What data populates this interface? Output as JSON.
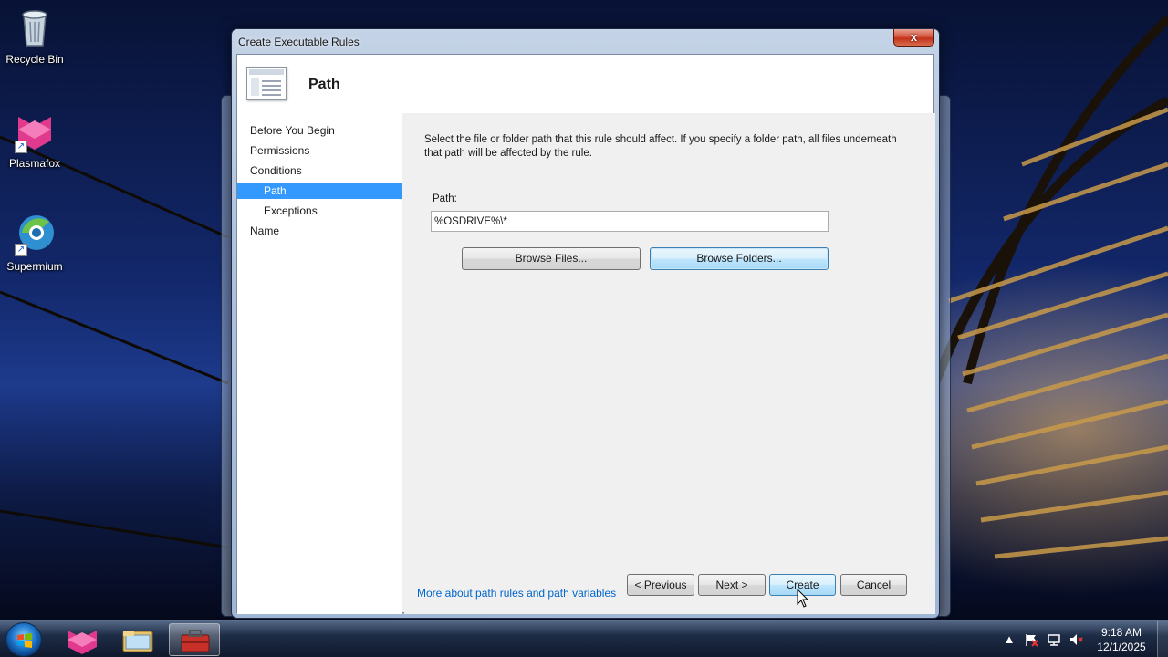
{
  "desktop": {
    "icons": [
      {
        "label": "Recycle Bin",
        "icon": "recycle-bin-icon"
      },
      {
        "label": "Plasmafox",
        "icon": "plasmafox-icon"
      },
      {
        "label": "Supermium",
        "icon": "supermium-icon"
      }
    ]
  },
  "dialog": {
    "title": "Create Executable Rules",
    "close_label": "x",
    "header_title": "Path",
    "nav": [
      {
        "label": "Before You Begin",
        "selected": false
      },
      {
        "label": "Permissions",
        "selected": false
      },
      {
        "label": "Conditions",
        "selected": false
      },
      {
        "label": "Path",
        "selected": true
      },
      {
        "label": "Exceptions",
        "selected": false
      },
      {
        "label": "Name",
        "selected": false
      }
    ],
    "description": "Select the file or folder path that this rule should affect. If you specify a folder path, all files underneath that path will be affected by the rule.",
    "path_label": "Path:",
    "path_value": "%OSDRIVE%\\*",
    "browse_files_label": "Browse Files...",
    "browse_folders_label": "Browse Folders...",
    "more_link": "More about path rules and path variables",
    "buttons": {
      "previous": "< Previous",
      "next": "Next >",
      "create": "Create",
      "cancel": "Cancel"
    }
  },
  "taskbar": {
    "pinned": [
      {
        "name": "plasmafox-icon",
        "active": false
      },
      {
        "name": "file-explorer-icon",
        "active": false
      },
      {
        "name": "toolbox-icon",
        "active": true
      }
    ],
    "clock_time": "9:18 AM",
    "clock_date": "12/1/2025"
  },
  "colors": {
    "selection": "#3399ff",
    "link": "#0066cc",
    "close_button": "#c2321a"
  }
}
